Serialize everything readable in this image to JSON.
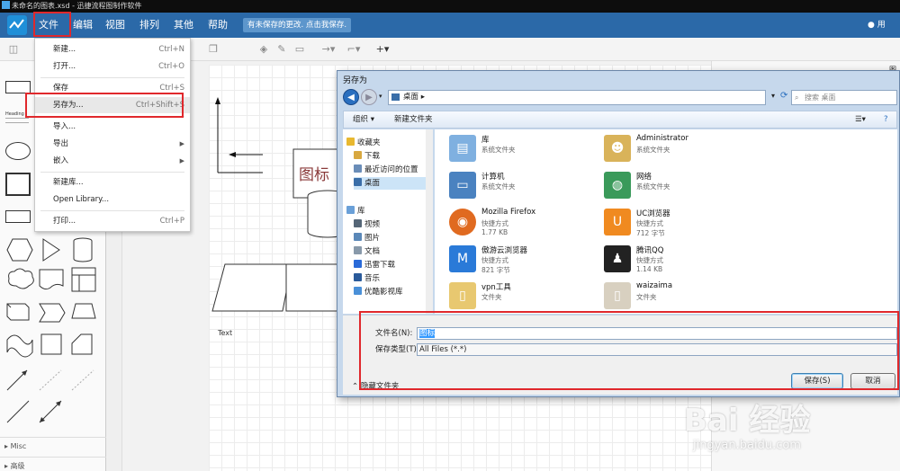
{
  "titlebar": {
    "text": "未命名的图表.xsd - 迅捷流程图制作软件"
  },
  "menubar": {
    "items": [
      "文件",
      "编辑",
      "视图",
      "排列",
      "其他",
      "帮助"
    ],
    "unsaved_notice": "有未保存的更改. 点击我保存.",
    "user": "用"
  },
  "file_menu": {
    "new": {
      "label": "新建...",
      "shortcut": "Ctrl+N"
    },
    "open": {
      "label": "打开...",
      "shortcut": "Ctrl+O"
    },
    "save": {
      "label": "保存",
      "shortcut": "Ctrl+S"
    },
    "save_as": {
      "label": "另存为...",
      "shortcut": "Ctrl+Shift+S"
    },
    "import": {
      "label": "导入..."
    },
    "export": {
      "label": "导出"
    },
    "embed": {
      "label": "嵌入"
    },
    "new_library": {
      "label": "新建库..."
    },
    "open_library": {
      "label": "Open Library..."
    },
    "print": {
      "label": "打印...",
      "shortcut": "Ctrl+P"
    }
  },
  "sidebar": {
    "heading_shape_label": "Heading",
    "sections": [
      "Misc",
      "高级"
    ]
  },
  "canvas": {
    "shape_label": "图标",
    "text_label": "Text"
  },
  "right_panel": {
    "label": "图"
  },
  "dialog": {
    "title": "另存为",
    "address": "桌面",
    "search_placeholder": "搜索 桌面",
    "organize": "组织 ▾",
    "new_folder": "新建文件夹",
    "nav": [
      {
        "label": "收藏夹",
        "icon": "star-icon",
        "color": "#e8b830"
      },
      {
        "label": "下载",
        "icon": "folder-icon",
        "color": "#d8a840"
      },
      {
        "label": "最近访问的位置",
        "icon": "recent-icon",
        "color": "#6a8db8"
      },
      {
        "label": "桌面",
        "icon": "desktop-icon",
        "color": "#3a6ea8"
      },
      {
        "label": "库",
        "icon": "library-icon",
        "color": "#6aa0d8"
      },
      {
        "label": "视频",
        "icon": "video-icon",
        "color": "#556677"
      },
      {
        "label": "图片",
        "icon": "picture-icon",
        "color": "#5a88b8"
      },
      {
        "label": "文档",
        "icon": "document-icon",
        "color": "#8899aa"
      },
      {
        "label": "迅雷下载",
        "icon": "thunder-icon",
        "color": "#2a6ad8"
      },
      {
        "label": "音乐",
        "icon": "music-icon",
        "color": "#2a5a9a"
      },
      {
        "label": "优酷影视库",
        "icon": "youku-icon",
        "color": "#4a90d8"
      }
    ],
    "files": [
      {
        "name": "库",
        "desc": "系统文件夹",
        "size": "",
        "color": "#7fb0e0",
        "icon": "library-folder-icon",
        "glyph": "▤"
      },
      {
        "name": "Administrator",
        "desc": "系统文件夹",
        "size": "",
        "color": "#d9b35a",
        "icon": "user-folder-icon",
        "glyph": "☻"
      },
      {
        "name": "计算机",
        "desc": "系统文件夹",
        "size": "",
        "color": "#4a82c0",
        "icon": "computer-icon",
        "glyph": "▭"
      },
      {
        "name": "网络",
        "desc": "系统文件夹",
        "size": "",
        "color": "#3a9a5a",
        "icon": "network-icon",
        "glyph": "◍"
      },
      {
        "name": "Mozilla Firefox",
        "desc": "快捷方式",
        "size": "1.77 KB",
        "color": "#e06a20",
        "icon": "firefox-icon",
        "glyph": "◉"
      },
      {
        "name": "UC浏览器",
        "desc": "快捷方式",
        "size": "712 字节",
        "color": "#f08a20",
        "icon": "uc-browser-icon",
        "glyph": "U"
      },
      {
        "name": "傲游云浏览器",
        "desc": "快捷方式",
        "size": "821 字节",
        "color": "#2a7ad8",
        "icon": "maxthon-icon",
        "glyph": "M"
      },
      {
        "name": "腾讯QQ",
        "desc": "快捷方式",
        "size": "1.14 KB",
        "color": "#222222",
        "icon": "qq-icon",
        "glyph": "♟"
      },
      {
        "name": "vpn工具",
        "desc": "文件夹",
        "size": "",
        "color": "#e8c870",
        "icon": "folder-icon",
        "glyph": "▯"
      },
      {
        "name": "waizaima",
        "desc": "文件夹",
        "size": "",
        "color": "#d8d0c0",
        "icon": "folder-icon",
        "glyph": "▯"
      }
    ],
    "filename_label": "文件名(N):",
    "filename_value": "图标",
    "filetype_label": "保存类型(T):",
    "filetype_value": "All Files (*.*)",
    "hide_folders": "隐藏文件夹",
    "save_button": "保存(S)",
    "cancel_button": "取消"
  },
  "watermark": {
    "main": "Bai 经验",
    "sub": "jingyan.baidu.com"
  },
  "colors": {
    "menubar": "#2b69a8",
    "highlight": "#e0282c",
    "dialog_frame": "#c6d8ec"
  }
}
